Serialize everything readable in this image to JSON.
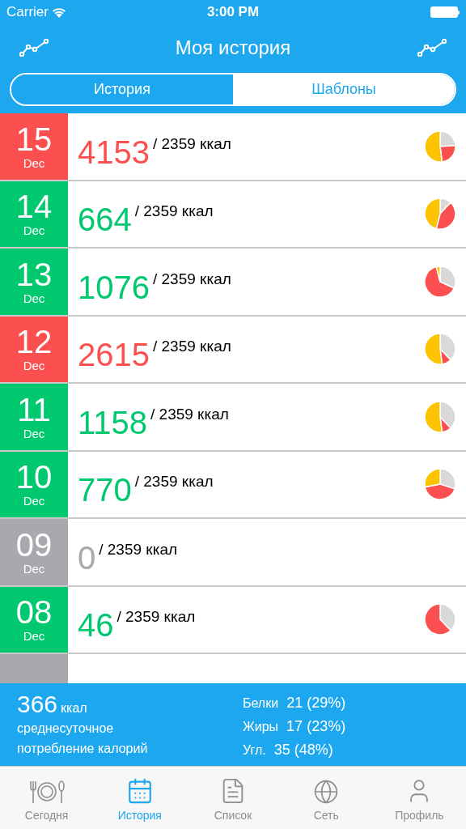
{
  "status_bar": {
    "carrier": "Carrier",
    "time": "3:00 PM"
  },
  "header": {
    "title": "Моя история"
  },
  "segments": [
    {
      "label": "История",
      "selected": true
    },
    {
      "label": "Шаблоны",
      "selected": false
    }
  ],
  "days": [
    {
      "day": "15",
      "month": "Dec",
      "color": "#fc4f4f",
      "calories": "4153",
      "goal": "/ 2359 ккал",
      "chart": true
    },
    {
      "day": "14",
      "month": "Dec",
      "color": "#00c86f",
      "calories": "664",
      "goal": "/ 2359 ккал",
      "chart": true
    },
    {
      "day": "13",
      "month": "Dec",
      "color": "#00c86f",
      "calories": "1076",
      "goal": "/ 2359 ккал",
      "chart": true
    },
    {
      "day": "12",
      "month": "Dec",
      "color": "#fc4f4f",
      "calories": "2615",
      "goal": "/ 2359 ккал",
      "chart": true
    },
    {
      "day": "11",
      "month": "Dec",
      "color": "#00c86f",
      "calories": "1158",
      "goal": "/ 2359 ккал",
      "chart": true
    },
    {
      "day": "10",
      "month": "Dec",
      "color": "#00c86f",
      "calories": "770",
      "goal": "/ 2359 ккал",
      "chart": true
    },
    {
      "day": "09",
      "month": "Dec",
      "color": "#a8a8ad",
      "calories": "0",
      "goal": "/ 2359 ккал",
      "chart": false
    },
    {
      "day": "08",
      "month": "Dec",
      "color": "#00c86f",
      "calories": "46",
      "goal": "/ 2359 ккал",
      "chart": true
    },
    {
      "color": "#a8a8ad"
    }
  ],
  "summary": {
    "value": "366",
    "unit": "ккал",
    "caption_1": "среднесуточное",
    "caption_2": "потребление калорий",
    "macros": [
      {
        "label": "Белки",
        "value": "21 (29%)"
      },
      {
        "label": "Жиры",
        "value": "17 (23%)"
      },
      {
        "label": "Угл.",
        "value": "35 (48%)"
      }
    ]
  },
  "tab_bar": [
    {
      "label": "Сегодня",
      "selected": false
    },
    {
      "label": "История",
      "selected": true
    },
    {
      "label": "Список",
      "selected": false
    },
    {
      "label": "Сеть",
      "selected": false
    },
    {
      "label": "Профиль",
      "selected": false
    }
  ]
}
